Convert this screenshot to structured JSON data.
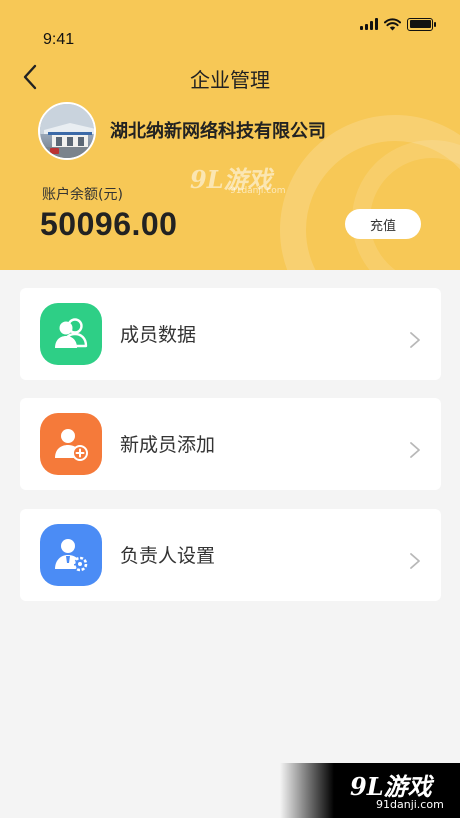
{
  "status_bar": {
    "time": "9:41"
  },
  "nav": {
    "title": "企业管理",
    "back_icon": "chevron-left-icon"
  },
  "company": {
    "name": "湖北纳新网络科技有限公司"
  },
  "account": {
    "balance_label": "账户余额(元)",
    "balance_value": "50096.00",
    "recharge_label": "充值"
  },
  "menu": [
    {
      "label": "成员数据",
      "icon": "members-icon",
      "color": "#2ecf86"
    },
    {
      "label": "新成员添加",
      "icon": "add-member-icon",
      "color": "#f57a3a"
    },
    {
      "label": "负责人设置",
      "icon": "manager-settings-icon",
      "color": "#4b8cf5"
    }
  ],
  "watermark": {
    "brand": "9L游戏",
    "site": "91danji.com"
  },
  "colors": {
    "header": "#f7c856",
    "background": "#f4f4f4"
  }
}
